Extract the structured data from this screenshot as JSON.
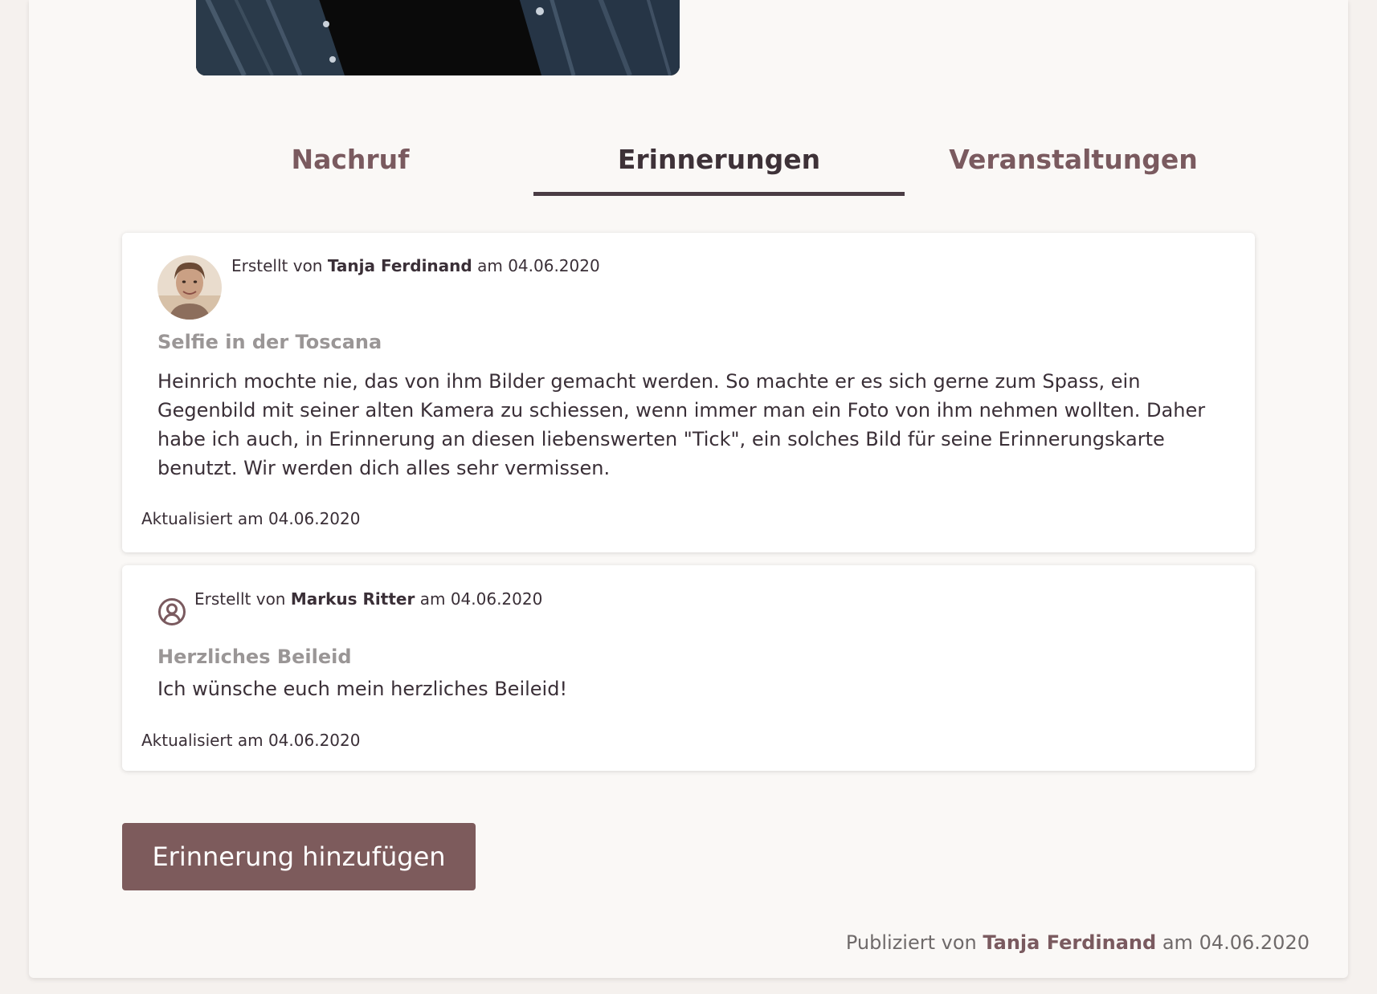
{
  "tabs": [
    {
      "label": "Nachruf",
      "active": false
    },
    {
      "label": "Erinnerungen",
      "active": true
    },
    {
      "label": "Veranstaltungen",
      "active": false
    }
  ],
  "memories": [
    {
      "created_prefix": "Erstellt von",
      "author": "Tanja Ferdinand",
      "created_mid": "am",
      "created_date": "04.06.2020",
      "avatar": "user-photo",
      "title": "Selfie in der Toscana",
      "body": "Heinrich mochte nie, das von ihm Bilder gemacht werden. So machte er es sich gerne zum Spass, ein Gegenbild mit seiner alten Kamera zu schiessen, wenn immer man ein Foto von ihm nehmen wollten. Daher habe ich auch, in Erinnerung an diesen liebenswerten \"Tick\", ein solches Bild für seine Erinnerungskarte benutzt. Wir werden dich alles sehr vermissen.",
      "updated": "Aktualisiert am 04.06.2020"
    },
    {
      "created_prefix": "Erstellt von",
      "author": "Markus Ritter",
      "created_mid": "am",
      "created_date": "04.06.2020",
      "avatar": "user-circle-icon",
      "title": "Herzliches Beileid",
      "body": "Ich wünsche euch mein herzliches Beileid!",
      "updated": "Aktualisiert am 04.06.2020"
    }
  ],
  "add_button_label": "Erinnerung hinzufügen",
  "footer": {
    "published_prefix": "Publiziert von",
    "publisher": "Tanja Ferdinand",
    "published_mid": "am",
    "published_date": "04.06.2020"
  },
  "colors": {
    "accent": "#7d5b5c",
    "tab_text": "#7a5a5f",
    "tab_active": "#3e3238",
    "title_muted": "#9a9696",
    "page_bg": "#faf8f6"
  }
}
